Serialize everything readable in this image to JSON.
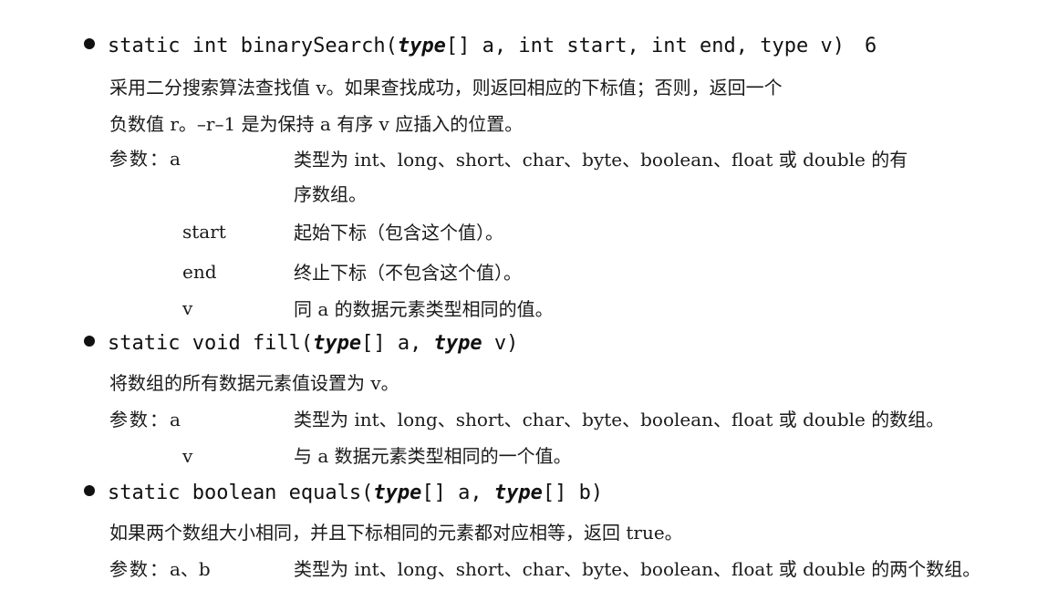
{
  "entries": [
    {
      "sig_pre": "static int binarySearch(",
      "sig_type": "type",
      "sig_mid": "[] a, int start, int end, type v)",
      "sig_ref": "6",
      "desc_line1": "采用二分搜索算法查找值 v。如果查找成功，则返回相应的下标值；否则，返回一个",
      "desc_line2": "负数值 r。–r–1 是为保持 a 有序 v 应插入的位置。",
      "param_label": "参数：",
      "params": [
        {
          "name": "a",
          "desc_line1": "类型为 int、long、short、char、byte、boolean、float 或 double 的有",
          "desc_line2": "序数组。"
        },
        {
          "name": "start",
          "desc": "起始下标（包含这个值）。"
        },
        {
          "name": "end",
          "desc": "终止下标（不包含这个值）。"
        },
        {
          "name": "v",
          "desc": "同 a 的数据元素类型相同的值。"
        }
      ]
    },
    {
      "sig_pre": "static void fill(",
      "sig_type1": "type",
      "sig_mid": "[] a, ",
      "sig_type2": "type",
      "sig_post": " v)",
      "desc": "将数组的所有数据元素值设置为 v。",
      "param_label": "参数：",
      "params": [
        {
          "name": "a",
          "desc": "类型为 int、long、short、char、byte、boolean、float 或 double 的数组。"
        },
        {
          "name": "v",
          "desc": "与 a 数据元素类型相同的一个值。"
        }
      ]
    },
    {
      "sig_pre": "static boolean equals(",
      "sig_type1": "type",
      "sig_mid": "[] a, ",
      "sig_type2": "type",
      "sig_post": "[] b)",
      "desc": "如果两个数组大小相同，并且下标相同的元素都对应相等，返回 true。",
      "param_label": "参数：",
      "params": [
        {
          "name": "a、b",
          "desc": "类型为 int、long、short、char、byte、boolean、float 或 double 的两个数组。"
        }
      ]
    }
  ]
}
